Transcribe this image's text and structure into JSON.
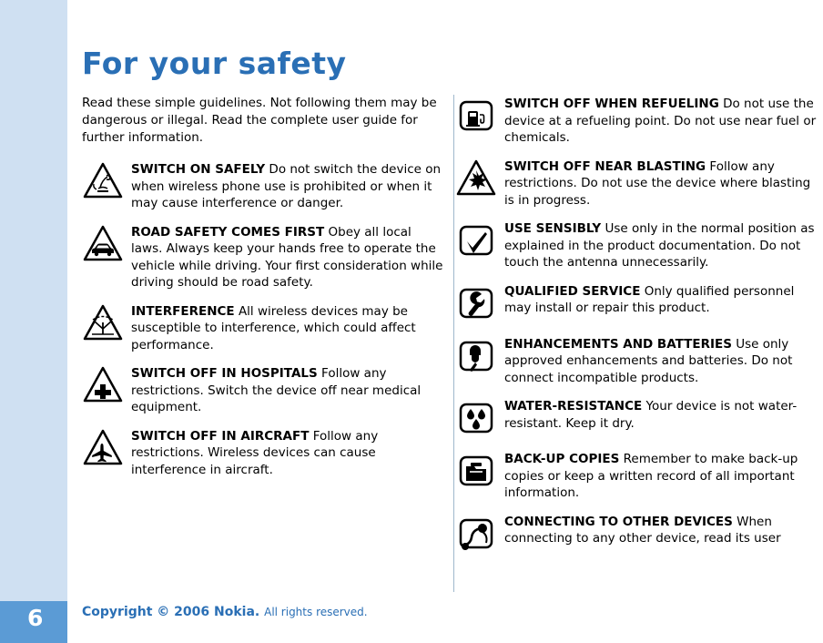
{
  "page": {
    "number": "6",
    "title": "For your safety",
    "intro": "Read these simple guidelines. Not following them may be dangerous or illegal. Read the complete user guide for further information.",
    "footer_main": "Copyright © 2006 Nokia.",
    "footer_rights": "All rights reserved."
  },
  "left_column": [
    {
      "icon": "switch-on-safely-icon",
      "heading": "SWITCH ON SAFELY",
      "body": "Do not switch the device on when wireless phone use is prohibited or when it may cause interference or danger."
    },
    {
      "icon": "road-safety-car-icon",
      "heading": "ROAD SAFETY COMES FIRST",
      "body": "Obey all local laws. Always keep your hands free to operate the vehicle while driving. Your first consideration while driving should be road safety."
    },
    {
      "icon": "interference-icon",
      "heading": "INTERFERENCE",
      "body": "All wireless devices may be susceptible to interference, which could affect performance."
    },
    {
      "icon": "hospital-cross-icon",
      "heading": "SWITCH OFF IN HOSPITALS",
      "body": "Follow any restrictions. Switch the device off near medical equipment."
    },
    {
      "icon": "aircraft-icon",
      "heading": "SWITCH OFF IN AIRCRAFT",
      "body": "Follow any restrictions. Wireless devices can cause interference in aircraft."
    }
  ],
  "right_column": [
    {
      "icon": "refueling-pump-icon",
      "heading": "SWITCH OFF WHEN REFUELING",
      "body": "Do not use the device at a refueling point. Do not use near fuel or chemicals."
    },
    {
      "icon": "blasting-explosion-icon",
      "heading": "SWITCH OFF NEAR BLASTING",
      "body": "Follow any restrictions. Do not use the device where blasting is in progress."
    },
    {
      "icon": "use-sensibly-check-icon",
      "heading": "USE SENSIBLY",
      "body": "Use only in the normal position as explained in the product documentation. Do not touch the antenna unnecessarily."
    },
    {
      "icon": "qualified-service-wrench-icon",
      "heading": "QUALIFIED SERVICE",
      "body": "Only qualified personnel may install or repair this product."
    },
    {
      "icon": "enhancements-batteries-plug-icon",
      "heading": "ENHANCEMENTS AND BATTERIES",
      "body": "Use only approved enhancements and batteries. Do not connect incompatible products."
    },
    {
      "icon": "water-resistance-drops-icon",
      "heading": "WATER-RESISTANCE",
      "body": "Your device is not water-resistant. Keep it dry."
    },
    {
      "icon": "backup-copies-icon",
      "heading": "BACK-UP COPIES",
      "body": "Remember to make back-up copies or keep a written record of all important information."
    },
    {
      "icon": "connect-other-devices-icon",
      "heading": "CONNECTING TO OTHER DEVICES",
      "body": "When connecting to any other device, read its user"
    }
  ]
}
